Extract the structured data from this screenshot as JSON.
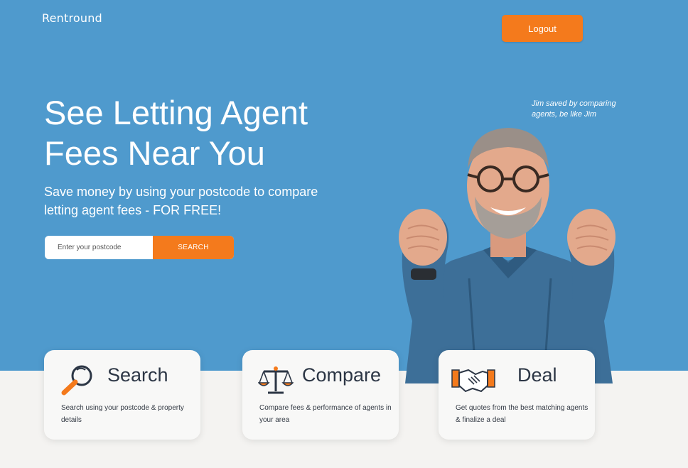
{
  "brand": {
    "name": "Rentround"
  },
  "header": {
    "logout_label": "Logout"
  },
  "hero": {
    "headline": "See Letting Agent Fees Near You",
    "subheadline": "Save money by using your postcode to compare letting agent fees - FOR FREE!",
    "search": {
      "placeholder": "Enter your postcode",
      "value": "",
      "button_label": "SEARCH"
    },
    "caption": "Jim saved by comparing agents, be like Jim"
  },
  "features": [
    {
      "title": "Search",
      "description": "Search using your postcode & property details",
      "icon": "magnifier-icon"
    },
    {
      "title": "Compare",
      "description": "Compare fees & performance of agents in your area",
      "icon": "scales-icon"
    },
    {
      "title": "Deal",
      "description": "Get quotes from the best matching agents & finalize a deal",
      "icon": "handshake-icon"
    }
  ],
  "colors": {
    "hero_background": "#4f9acd",
    "accent": "#f47a1c",
    "text_dark": "#2c3645",
    "page_background": "#f4f3f1"
  }
}
